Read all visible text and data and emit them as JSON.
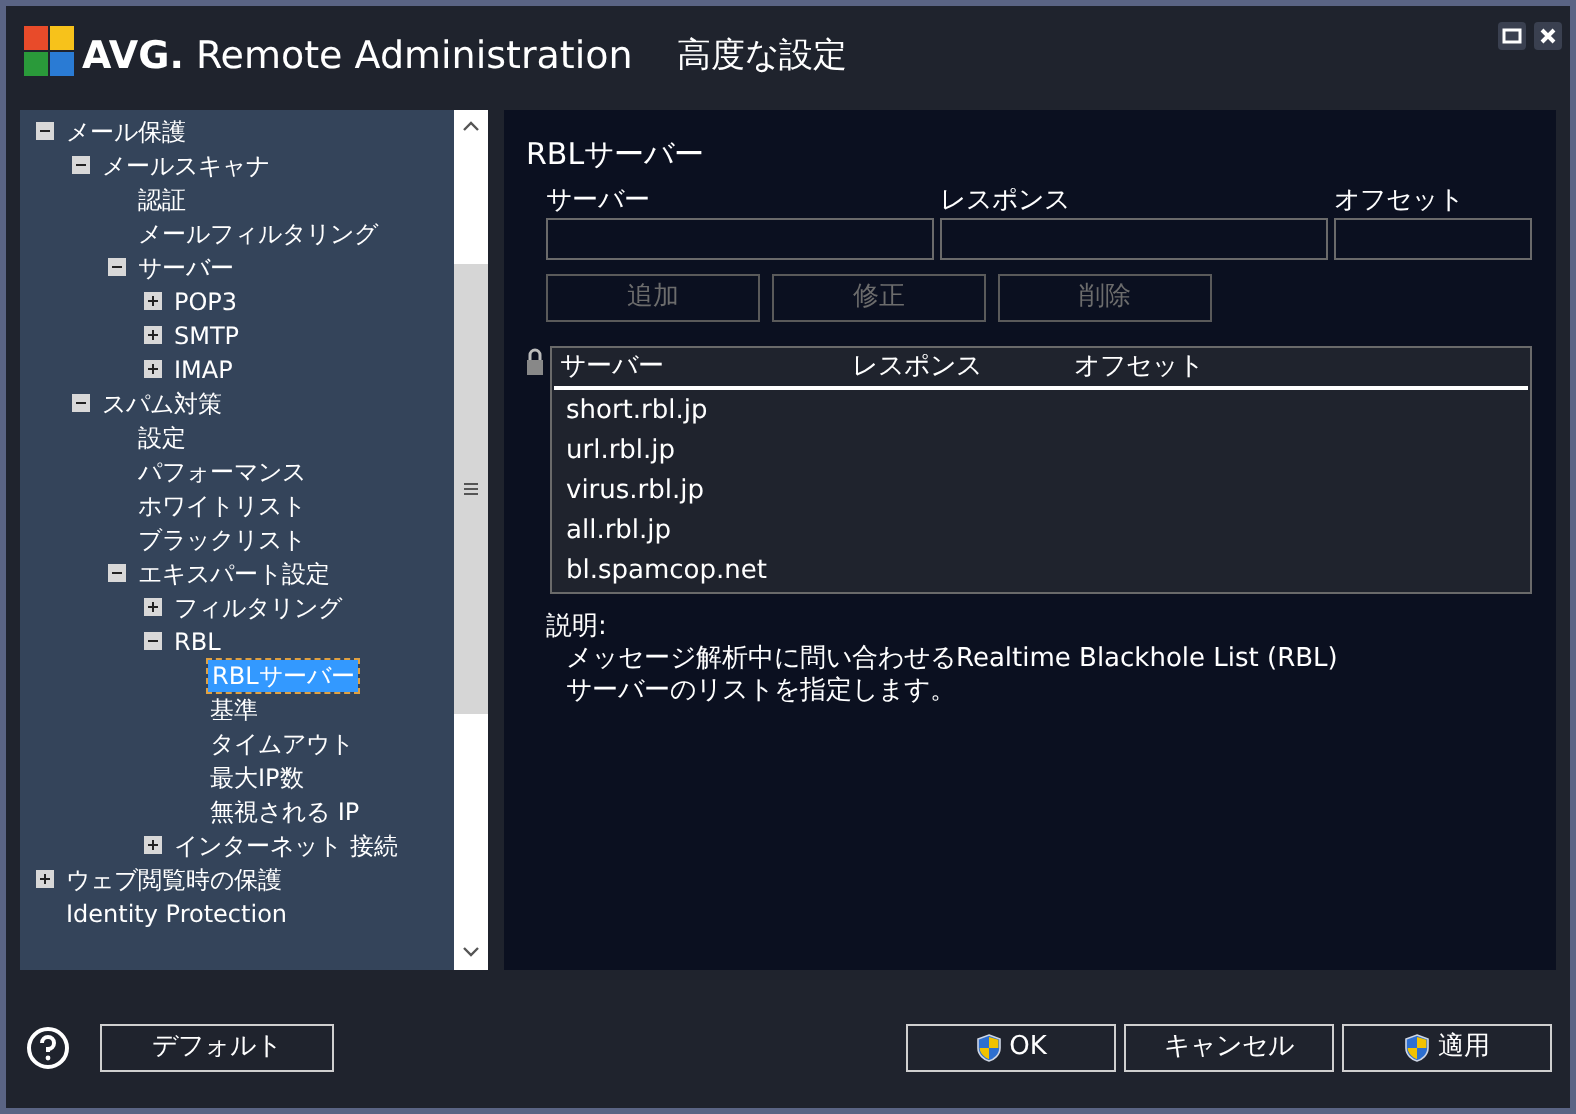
{
  "window": {
    "logo_text": "AVG.",
    "product": "Remote Administration",
    "title": "高度な設定"
  },
  "tree": [
    {
      "label": "メール保護",
      "kind": "branch",
      "expanded": true,
      "selected": false,
      "children": [
        {
          "label": "メールスキャナ",
          "kind": "branch",
          "expanded": true,
          "selected": false,
          "children": [
            {
              "label": "認証",
              "kind": "leaf",
              "selected": false
            },
            {
              "label": "メールフィルタリング",
              "kind": "leaf",
              "selected": false
            },
            {
              "label": "サーバー",
              "kind": "branch",
              "expanded": true,
              "selected": false,
              "children": [
                {
                  "label": "POP3",
                  "kind": "branch",
                  "expanded": false,
                  "selected": false
                },
                {
                  "label": "SMTP",
                  "kind": "branch",
                  "expanded": false,
                  "selected": false
                },
                {
                  "label": "IMAP",
                  "kind": "branch",
                  "expanded": false,
                  "selected": false
                }
              ]
            }
          ]
        },
        {
          "label": "スパム対策",
          "kind": "branch",
          "expanded": true,
          "selected": false,
          "children": [
            {
              "label": "設定",
              "kind": "leaf",
              "selected": false
            },
            {
              "label": "パフォーマンス",
              "kind": "leaf",
              "selected": false
            },
            {
              "label": "ホワイトリスト",
              "kind": "leaf",
              "selected": false
            },
            {
              "label": "ブラックリスト",
              "kind": "leaf",
              "selected": false
            },
            {
              "label": "エキスパート設定",
              "kind": "branch",
              "expanded": true,
              "selected": false,
              "children": [
                {
                  "label": "フィルタリング",
                  "kind": "branch",
                  "expanded": false,
                  "selected": false
                },
                {
                  "label": "RBL",
                  "kind": "branch",
                  "expanded": true,
                  "selected": false,
                  "children": [
                    {
                      "label": "RBLサーバー",
                      "kind": "leaf",
                      "selected": true
                    },
                    {
                      "label": "基準",
                      "kind": "leaf",
                      "selected": false
                    },
                    {
                      "label": "タイムアウト",
                      "kind": "leaf",
                      "selected": false
                    },
                    {
                      "label": "最大IP数",
                      "kind": "leaf",
                      "selected": false
                    },
                    {
                      "label": "無視される IP",
                      "kind": "leaf",
                      "selected": false
                    }
                  ]
                },
                {
                  "label": "インターネット 接続",
                  "kind": "branch",
                  "expanded": false,
                  "selected": false
                }
              ]
            }
          ]
        }
      ]
    },
    {
      "label": "ウェブ閲覧時の保護",
      "kind": "branch",
      "expanded": false,
      "selected": false
    },
    {
      "label": "Identity Protection",
      "kind": "leaf",
      "selected": false
    }
  ],
  "panel": {
    "heading": "RBLサーバー",
    "fields": [
      {
        "label": "サーバー"
      },
      {
        "label": "レスポンス"
      },
      {
        "label": "オフセット"
      }
    ],
    "buttons": [
      {
        "label": "追加",
        "disabled": true
      },
      {
        "label": "修正",
        "disabled": true
      },
      {
        "label": "削除",
        "disabled": true
      }
    ],
    "table": {
      "columns": [
        "サーバー",
        "レスポンス",
        "オフセット"
      ],
      "rows": [
        [
          "short.rbl.jp"
        ],
        [
          "url.rbl.jp"
        ],
        [
          "virus.rbl.jp"
        ],
        [
          "all.rbl.jp"
        ],
        [
          "bl.spamcop.net"
        ]
      ]
    },
    "description": {
      "label": "説明:",
      "lines": [
        "メッセージ解析中に問い合わせるRealtime Blackhole List (RBL)",
        "サーバーのリストを指定します。"
      ]
    }
  },
  "footer": {
    "default_button": "デフォルト",
    "buttons": [
      {
        "label": "OK",
        "shield": true
      },
      {
        "label": "キャンセル",
        "shield": false
      },
      {
        "label": "適用",
        "shield": true
      }
    ]
  }
}
